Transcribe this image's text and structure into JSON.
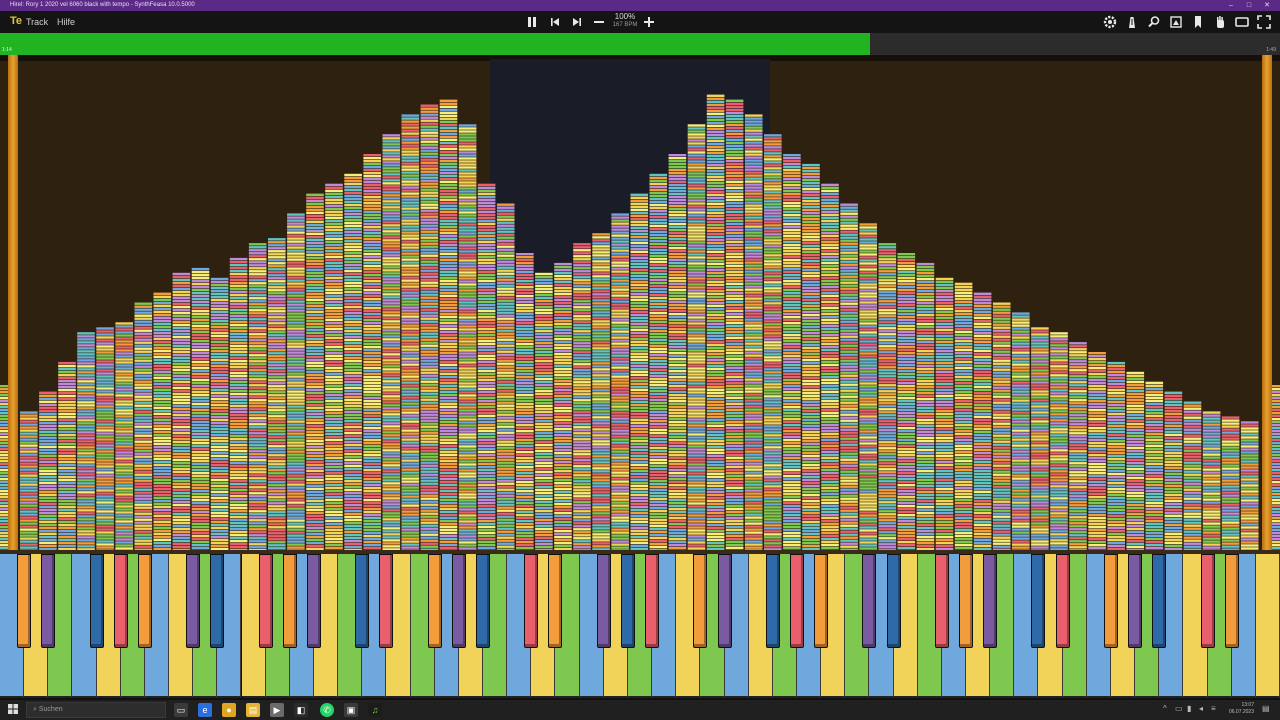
{
  "window": {
    "title": "Hirel: Rory 1 2020 vel 6060 black with tempo  -  SynthFeasa 10.0.5000",
    "controls": [
      "–",
      "□",
      "✕"
    ]
  },
  "menu": {
    "logo": "Te",
    "items": [
      "Track",
      "Hilfe"
    ]
  },
  "toolbar": {
    "zoom_label": "100%",
    "bpm_label": "167 BPM",
    "transport_icons": [
      "pause-icon",
      "skip-back-icon",
      "skip-forward-icon",
      "minus-icon",
      "plus-icon"
    ],
    "right_icons": [
      "gear-icon",
      "metronome-icon",
      "search-icon",
      "export-icon",
      "bookmark-icon",
      "hand-icon",
      "window-icon",
      "fullscreen-icon"
    ]
  },
  "progress": {
    "value": 0.68,
    "start_label": "1:14",
    "end_label": "1:49",
    "fill_color": "#22b322"
  },
  "roll": {
    "background_color": "#2e2110",
    "rail_color": "#e8a22c",
    "note_colors": [
      "#f2d35a",
      "#e95f6c",
      "#7ec850",
      "#6fa8dc",
      "#f39c3c",
      "#c08ad8",
      "#f6ee7a",
      "#62c3c1"
    ],
    "column_heights_pct": [
      28,
      32,
      38,
      44,
      45,
      46,
      50,
      52,
      56,
      57,
      55,
      59,
      62,
      63,
      68,
      72,
      74,
      76,
      80,
      84,
      88,
      90,
      91,
      86,
      74,
      70,
      60,
      56,
      58,
      62,
      64,
      68,
      72,
      76,
      80,
      86,
      92,
      91,
      88,
      84,
      80,
      78,
      74,
      70,
      66,
      62,
      60,
      58,
      55,
      54,
      52,
      50,
      48,
      45,
      44,
      42,
      40,
      38,
      36,
      34,
      32,
      30,
      28,
      27,
      26
    ]
  },
  "keyboard": {
    "white_key_colors": [
      "#6fa8dc",
      "#f6ee7a",
      "#7ec850",
      "#f39c3c",
      "#e95f6c",
      "#f2d35a",
      "#c08ad8",
      "#62c3c1"
    ],
    "black_key_colors": [
      "#f39c3c",
      "#e95f6c",
      "#2f8a2f",
      "#2f6aa8",
      "#7a5aa0",
      "#d43c3c"
    ]
  },
  "taskbar": {
    "search_placeholder": "Suchen",
    "clock_time": "13:07",
    "clock_date": "06.07.2023",
    "apps": [
      "task-view-icon",
      "browser-edge-icon",
      "browser-chrome-icon",
      "file-explorer-icon",
      "media-icon",
      "whatsapp-icon",
      "store-icon",
      "synthesia-icon"
    ]
  }
}
